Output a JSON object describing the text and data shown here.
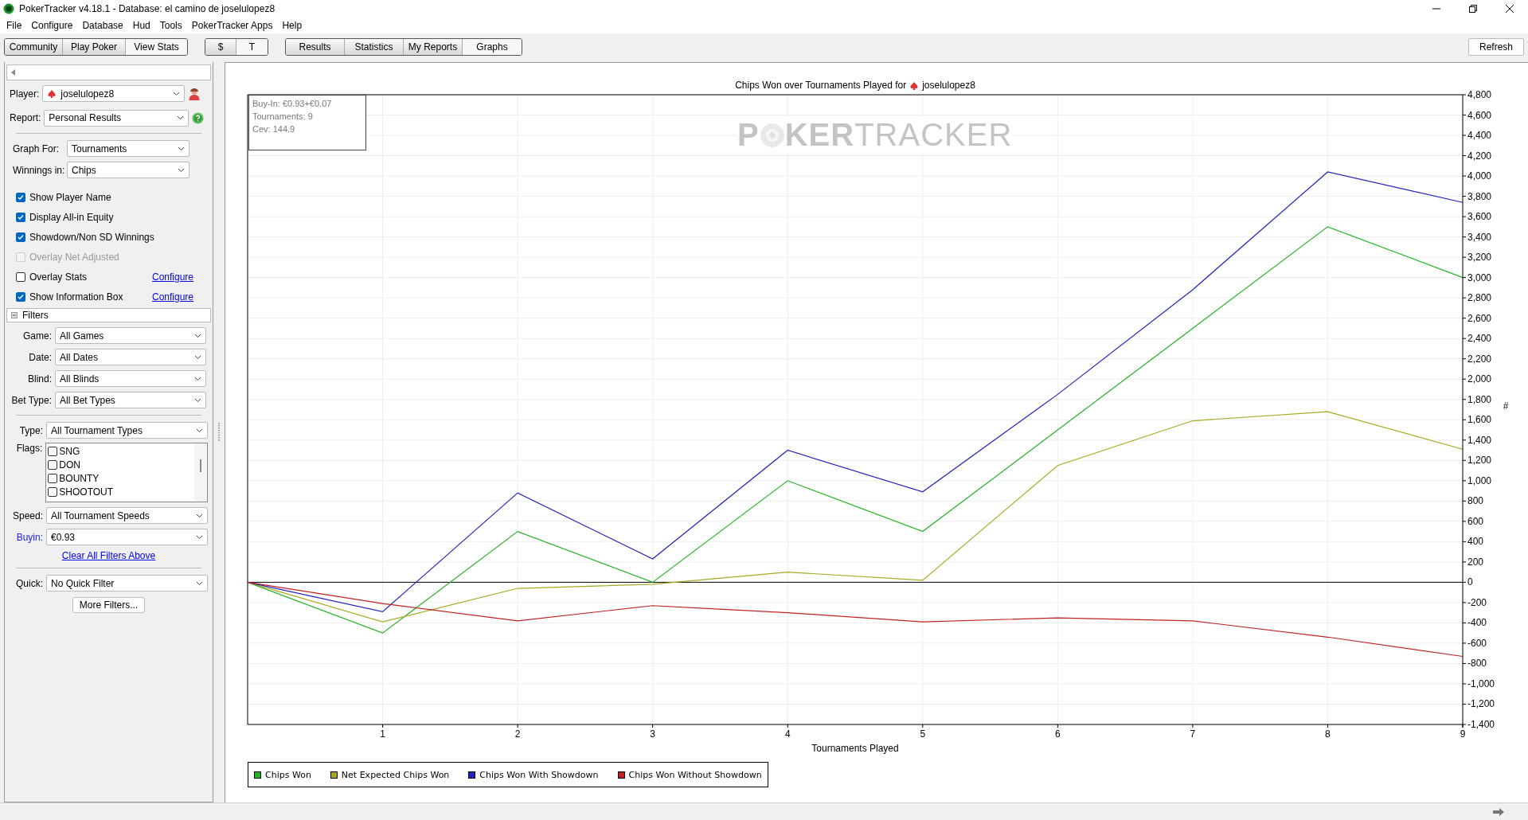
{
  "window": {
    "title": "PokerTracker v4.18.1 - Database: el camino de joselulopez8"
  },
  "menu": [
    "File",
    "Configure",
    "Database",
    "Hud",
    "Tools",
    "PokerTracker Apps",
    "Help"
  ],
  "toolbar": {
    "nav": [
      {
        "label": "Community",
        "selected": false
      },
      {
        "label": "Play Poker",
        "selected": false
      },
      {
        "label": "View Stats",
        "selected": true
      }
    ],
    "currency": [
      {
        "label": "$",
        "selected": false
      },
      {
        "label": "T",
        "selected": true
      }
    ],
    "views": [
      {
        "label": "Results",
        "selected": false
      },
      {
        "label": "Statistics",
        "selected": false
      },
      {
        "label": "My Reports",
        "selected": false
      },
      {
        "label": "Graphs",
        "selected": true
      }
    ],
    "refresh": "Refresh"
  },
  "sidebar": {
    "player": {
      "label": "Player:",
      "value": "joselulopez8"
    },
    "report": {
      "label": "Report:",
      "value": "Personal Results"
    },
    "graph_for": {
      "label": "Graph For:",
      "value": "Tournaments"
    },
    "winnings_in": {
      "label": "Winnings in:",
      "value": "Chips"
    },
    "options": [
      {
        "label": "Show Player Name",
        "checked": true,
        "disabled": false
      },
      {
        "label": "Display All-in Equity",
        "checked": true,
        "disabled": false
      },
      {
        "label": "Showdown/Non SD Winnings",
        "checked": true,
        "disabled": false
      },
      {
        "label": "Overlay Net Adjusted",
        "checked": false,
        "disabled": true
      },
      {
        "label": "Overlay Stats",
        "checked": false,
        "disabled": false,
        "link": "Configure"
      },
      {
        "label": "Show Information Box",
        "checked": true,
        "disabled": false,
        "link": "Configure"
      }
    ],
    "filters": {
      "label": "Filters",
      "expanded": true,
      "general": [
        {
          "label": "Game:",
          "value": "All Games"
        },
        {
          "label": "Date:",
          "value": "All Dates"
        },
        {
          "label": "Blind:",
          "value": "All Blinds"
        },
        {
          "label": "Bet Type:",
          "value": "All Bet Types"
        }
      ],
      "type": {
        "label": "Type:",
        "value": "All Tournament Types"
      },
      "flags": {
        "label": "Flags:",
        "items": [
          {
            "label": "SNG",
            "checked": false
          },
          {
            "label": "DON",
            "checked": false
          },
          {
            "label": "BOUNTY",
            "checked": false
          },
          {
            "label": "SHOOTOUT",
            "checked": false
          }
        ]
      },
      "more": [
        {
          "label": "Speed:",
          "value": "All Tournament Speeds",
          "active": false
        },
        {
          "label": "Buyin:",
          "value": "€0.93",
          "active": true
        }
      ],
      "clear_link": "Clear All Filters Above",
      "quick": {
        "label": "Quick:",
        "value": "No Quick Filter"
      },
      "more_button": "More Filters..."
    }
  },
  "graph": {
    "title_player": "joselulopez8",
    "watermark": {
      "before": "P",
      "after": "KER",
      "tail": "TRACKER"
    },
    "info_box": [
      "Buy-In: €0.93+€0.07",
      "Tournaments: 9",
      "Cev: 144.9"
    ],
    "chart_data": {
      "type": "line",
      "title": "Chips Won over Tournaments Played for",
      "xlabel": "Tournaments Played",
      "ylabel": "#",
      "x": [
        0,
        1,
        2,
        3,
        4,
        5,
        6,
        7,
        8,
        9
      ],
      "series": [
        {
          "name": "Chips Won",
          "color": "#22b322",
          "values": [
            0,
            -500,
            500,
            0,
            1000,
            500,
            1500,
            2500,
            3500,
            3000
          ]
        },
        {
          "name": "Net Expected Chips Won",
          "color": "#a8a822",
          "values": [
            0,
            -390,
            -60,
            -20,
            100,
            20,
            1150,
            1590,
            1680,
            1310
          ]
        },
        {
          "name": "Chips Won With Showdown",
          "color": "#2222c0",
          "values": [
            0,
            -290,
            880,
            230,
            1300,
            890,
            1850,
            2880,
            4040,
            3740
          ]
        },
        {
          "name": "Chips Won Without Showdown",
          "color": "#c02222",
          "values": [
            0,
            -210,
            -380,
            -230,
            -300,
            -390,
            -350,
            -380,
            -540,
            -730
          ]
        }
      ],
      "grid": true,
      "xlim": [
        0,
        9
      ],
      "ylim": [
        -1400,
        4800
      ],
      "xticks": [
        1,
        2,
        3,
        4,
        5,
        6,
        7,
        8,
        9
      ],
      "yticks": [
        {
          "value": -1400,
          "label": "-1,400"
        },
        {
          "value": -1200,
          "label": "-1,200"
        },
        {
          "value": -1000,
          "label": "-1,000"
        },
        -800,
        -600,
        -400,
        -200,
        0,
        200,
        400,
        600,
        800,
        {
          "value": 1000,
          "label": "1,000"
        },
        {
          "value": 1200,
          "label": "1,200"
        },
        {
          "value": 1400,
          "label": "1,400"
        },
        {
          "value": 1600,
          "label": "1,600"
        },
        {
          "value": 1800,
          "label": "1,800"
        },
        {
          "value": 2000,
          "label": "2,000"
        },
        {
          "value": 2200,
          "label": "2,200"
        },
        {
          "value": 2400,
          "label": "2,400"
        },
        {
          "value": 2600,
          "label": "2,600"
        },
        {
          "value": 2800,
          "label": "2,800"
        },
        {
          "value": 3000,
          "label": "3,000"
        },
        {
          "value": 3200,
          "label": "3,200"
        },
        {
          "value": 3400,
          "label": "3,400"
        },
        {
          "value": 3600,
          "label": "3,600"
        },
        {
          "value": 3800,
          "label": "3,800"
        },
        {
          "value": 4000,
          "label": "4,000"
        },
        {
          "value": 4200,
          "label": "4,200"
        },
        {
          "value": 4400,
          "label": "4,400"
        },
        {
          "value": 4600,
          "label": "4,600"
        },
        {
          "value": 4800,
          "label": "4,800"
        }
      ]
    }
  }
}
